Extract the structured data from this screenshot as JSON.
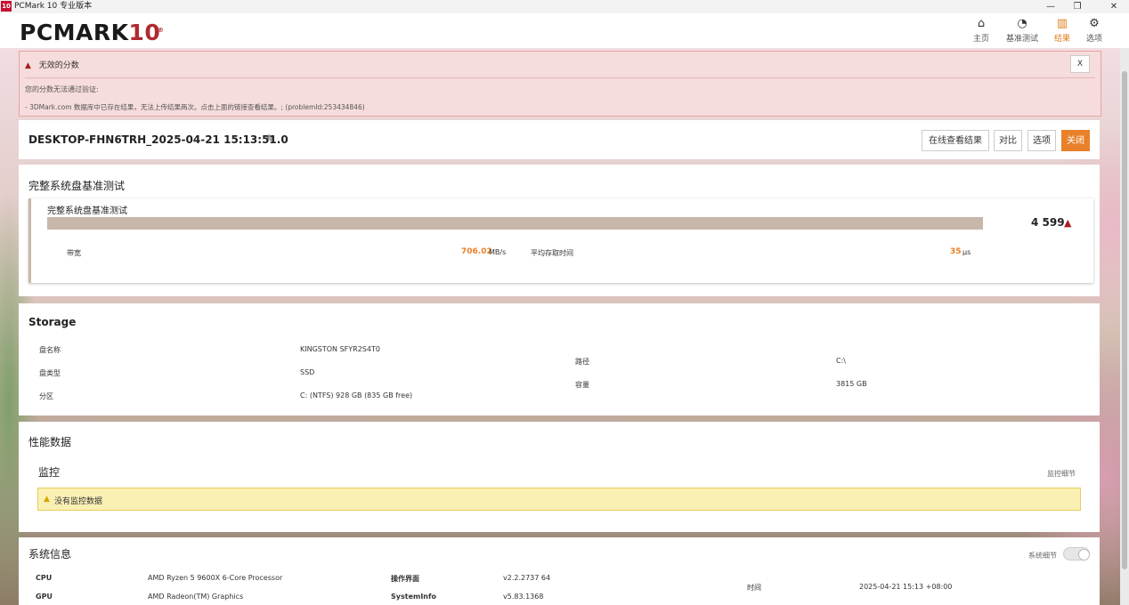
{
  "window": {
    "app_icon_text": "10",
    "title": "PCMark 10 专业版本",
    "minimize": "—",
    "maximize": "❐",
    "close": "✕"
  },
  "header": {
    "logo": {
      "text": "PCMARK",
      "num": "10",
      "reg": "®"
    },
    "nav": [
      {
        "label": "主页",
        "icon": "home-icon",
        "glyph": "⌂"
      },
      {
        "label": "基准测试",
        "icon": "gauge-icon",
        "glyph": "◔"
      },
      {
        "label": "结果",
        "icon": "bar-chart-icon",
        "glyph": "▥",
        "active": true
      },
      {
        "label": "选项",
        "icon": "gear-icon",
        "glyph": "⚙"
      }
    ]
  },
  "alert": {
    "icon": "warning-icon",
    "glyph": "▲",
    "title": "无效的分数",
    "close": "X",
    "message1": "您的分数无法通过验证:",
    "message2": "- 3DMark.com 数据库中已存在结果，无法上传结果两次。点击上面的链接查看结果。; (problemId:253434846)"
  },
  "result": {
    "name": "DESKTOP-FHN6TRH_2025-04-21 15:13:51.0",
    "edit_glyph": "✎",
    "buttons": {
      "online": "在线查看结果",
      "compare": "对比",
      "options": "选项",
      "close": "关闭"
    }
  },
  "benchmark": {
    "section_title": "完整系统盘基准测试",
    "test_name": "完整系统盘基准测试",
    "score": "4 599",
    "score_warn": "▲",
    "bandwidth_label": "带宽",
    "bandwidth_value": "706.02",
    "bandwidth_unit": "MB/s",
    "latency_label": "平均存取时间",
    "latency_value": "35",
    "latency_unit": "μs"
  },
  "storage": {
    "title": "Storage",
    "rows": [
      {
        "label": "盘名称",
        "value": "KINGSTON SFYR2S4T0"
      },
      {
        "label": "盘类型",
        "value": "SSD"
      },
      {
        "label": "分区",
        "value": "C: (NTFS) 928 GB (835 GB free)"
      }
    ],
    "right_rows": [
      {
        "label": "路径",
        "value": "C:\\"
      },
      {
        "label": "容量",
        "value": "3815 GB"
      }
    ]
  },
  "performance": {
    "title": "性能数据",
    "monitor_title": "监控",
    "monitor_details": "监控细节",
    "no_data_glyph": "▲",
    "no_data": "没有监控数据"
  },
  "sysinfo": {
    "title": "系统信息",
    "details": "系统细节",
    "rows": [
      {
        "label": "CPU",
        "value": "AMD Ryzen 5 9600X 6-Core Processor",
        "label2": "操作界面",
        "value2": "v2.2.2737 64"
      },
      {
        "label": "GPU",
        "value": "AMD Radeon(TM) Graphics",
        "label2": "SystemInfo",
        "value2": "v5.83.1368"
      }
    ],
    "time_label": "时间",
    "time_value": "2025-04-21 15:13 +08:00"
  },
  "colors": {
    "accent": "#e8812a",
    "alert_bg": "#f6dcdc",
    "warn": "#a61f1f",
    "score_bar": "#c7b8aa"
  }
}
